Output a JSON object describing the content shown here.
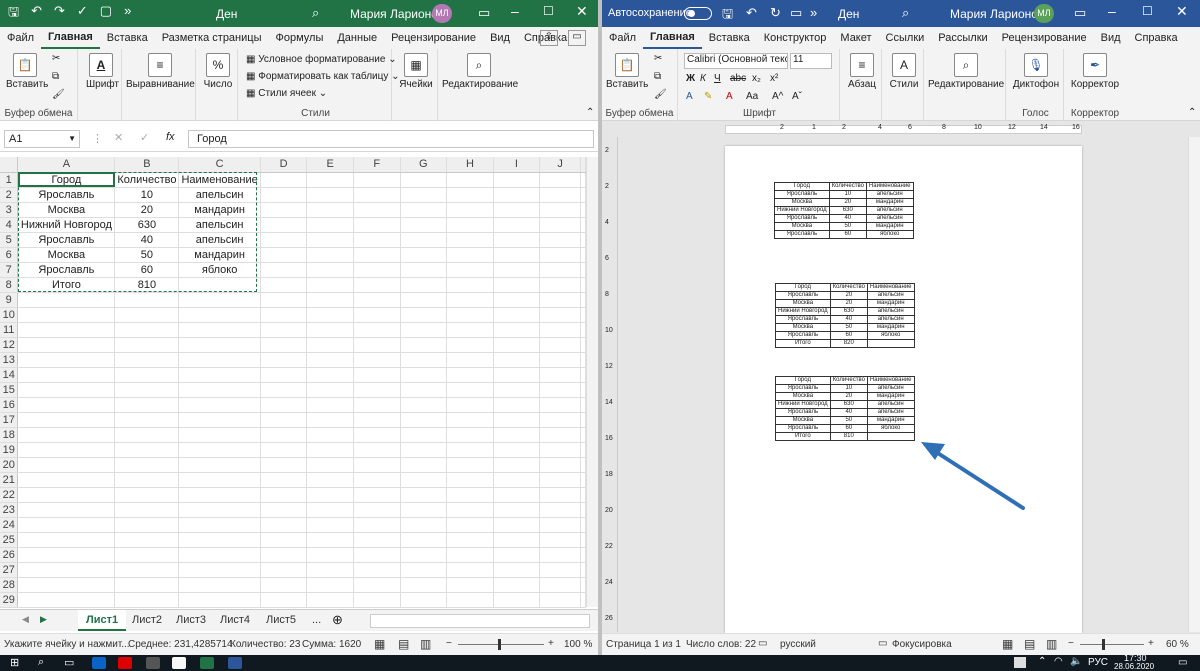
{
  "excel": {
    "title": "Ден",
    "user": "Мария Ларионова",
    "avatar": "МЛ",
    "tabs": [
      "Файл",
      "Главная",
      "Вставка",
      "Разметка страницы",
      "Формулы",
      "Данные",
      "Рецензирование",
      "Вид",
      "Справка"
    ],
    "ribbon": {
      "paste": "Вставить",
      "clipboard": "Буфер обмена",
      "font": "Шрифт",
      "alignment": "Выравнивание",
      "number": "Число",
      "number_symbol": "%",
      "cond_format": "Условное форматирование",
      "format_table": "Форматировать как таблицу",
      "cell_styles": "Стили ячеек",
      "styles": "Стили",
      "cells": "Ячейки",
      "editing": "Редактирование"
    },
    "namebox": "A1",
    "formula": "Город",
    "columns": [
      "A",
      "B",
      "C",
      "D",
      "E",
      "F",
      "G",
      "H",
      "I",
      "J"
    ],
    "rows": [
      [
        "Город",
        "Количество",
        "Наименование"
      ],
      [
        "Ярославль",
        "10",
        "апельсин"
      ],
      [
        "Москва",
        "20",
        "мандарин"
      ],
      [
        "Нижний Новгород",
        "630",
        "апельсин"
      ],
      [
        "Ярославль",
        "40",
        "апельсин"
      ],
      [
        "Москва",
        "50",
        "мандарин"
      ],
      [
        "Ярославль",
        "60",
        "яблоко"
      ],
      [
        "Итого",
        "810",
        ""
      ]
    ],
    "row_numbers": [
      "1",
      "2",
      "3",
      "4",
      "5",
      "6",
      "7",
      "8",
      "9",
      "10",
      "11",
      "12",
      "13",
      "14",
      "15",
      "16",
      "17",
      "18",
      "19",
      "20",
      "21",
      "22",
      "23",
      "24",
      "25",
      "26",
      "27",
      "28",
      "29"
    ],
    "sheets": [
      "Лист1",
      "Лист2",
      "Лист3",
      "Лист4",
      "Лист5"
    ],
    "sheets_more": "...",
    "status": {
      "hint": "Укажите ячейку и нажмит...",
      "average": "Среднее: 231,4285714",
      "count": "Количество: 23",
      "sum": "Сумма: 1620",
      "zoom": "100 %"
    }
  },
  "word": {
    "autosave": "Автосохранение",
    "title": "Ден",
    "user": "Мария Ларионова",
    "avatar": "МЛ",
    "tabs": [
      "Файл",
      "Главная",
      "Вставка",
      "Конструктор",
      "Макет",
      "Ссылки",
      "Рассылки",
      "Рецензирование",
      "Вид",
      "Справка"
    ],
    "ribbon": {
      "paste": "Вставить",
      "clipboard": "Буфер обмена",
      "font_name": "Calibri (Основной текст)",
      "font_size": "11",
      "font": "Шрифт",
      "paragraph": "Абзац",
      "styles": "Стили",
      "editing": "Редактирование",
      "dictation": "Диктофон",
      "voice": "Голос",
      "editor": "Корректор",
      "editor_group": "Корректор"
    },
    "ruler_marks": [
      "1",
      "2",
      "1",
      "2",
      "4",
      "6",
      "8",
      "10",
      "12",
      "14",
      "16"
    ],
    "vruler_marks": [
      "2",
      "2",
      "4",
      "6",
      "8",
      "10",
      "12",
      "14",
      "16",
      "18",
      "20",
      "22",
      "24",
      "26"
    ],
    "table1": [
      [
        "Город",
        "Количество",
        "Наименование"
      ],
      [
        "Ярославль",
        "10",
        "апельсин"
      ],
      [
        "Москва",
        "20",
        "мандарин"
      ],
      [
        "Нижний Новгород",
        "630",
        "апельсин"
      ],
      [
        "Ярославль",
        "40",
        "апельсин"
      ],
      [
        "Москва",
        "50",
        "мандарин"
      ],
      [
        "Ярославль",
        "60",
        "яблоко"
      ]
    ],
    "table2": [
      [
        "Город",
        "Количество",
        "Наименование"
      ],
      [
        "Ярославль",
        "20",
        "апельсин"
      ],
      [
        "Москва",
        "20",
        "мандарин"
      ],
      [
        "Нижний Новгород",
        "630",
        "апельсин"
      ],
      [
        "Ярославль",
        "40",
        "апельсин"
      ],
      [
        "Москва",
        "50",
        "мандарин"
      ],
      [
        "Ярославль",
        "60",
        "яблоко"
      ],
      [
        "Итого",
        "820",
        ""
      ]
    ],
    "table3": [
      [
        "Город",
        "Количество",
        "Наименование"
      ],
      [
        "Ярославль",
        "10",
        "апельсин"
      ],
      [
        "Москва",
        "20",
        "мандарин"
      ],
      [
        "Нижний Новгород",
        "630",
        "апельсин"
      ],
      [
        "Ярославль",
        "40",
        "апельсин"
      ],
      [
        "Москва",
        "50",
        "мандарин"
      ],
      [
        "Ярославль",
        "60",
        "яблоко"
      ],
      [
        "Итого",
        "810",
        ""
      ]
    ],
    "status": {
      "page": "Страница 1 из 1",
      "words": "Число слов: 22",
      "lang": "русский",
      "focus": "Фокусировка",
      "zoom": "60 %"
    }
  },
  "taskbar": {
    "lang": "РУС",
    "time": "17:30",
    "date": "28.06.2020"
  },
  "colors": {
    "excel": "#217346",
    "word": "#2b579a",
    "arrow": "#2f6fb5"
  }
}
